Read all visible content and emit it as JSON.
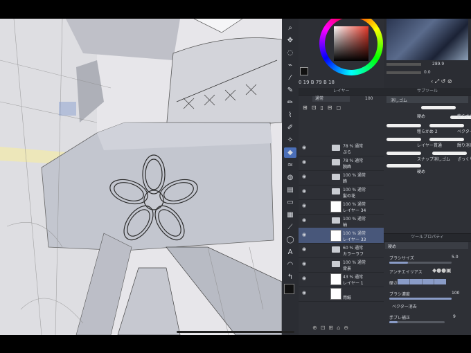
{
  "color": {
    "fg": "#111111",
    "bg": "#ffffff",
    "accent": "#4b6fb8",
    "readout": "0 19 B 79 B 18"
  },
  "navigator": {
    "zoom": "289.9",
    "angle": "0.0"
  },
  "layer_panel": {
    "title": "レイヤー",
    "blend_mode": "通常",
    "opacity": "100",
    "layers": [
      {
        "line1": "78 % 通常",
        "line2": "ぶら",
        "type": "folder",
        "selected": false
      },
      {
        "line1": "78 % 通常",
        "line2": "腕飾",
        "type": "folder",
        "selected": false
      },
      {
        "line1": "100 % 通常",
        "line2": "飾",
        "type": "folder",
        "selected": false
      },
      {
        "line1": "100 % 通常",
        "line2": "髪の花",
        "type": "folder",
        "selected": false
      },
      {
        "line1": "100 % 通常",
        "line2": "レイヤー 34",
        "type": "raster",
        "selected": false
      },
      {
        "line1": "100 % 通常",
        "line2": "袖",
        "type": "folder",
        "selected": false
      },
      {
        "line1": "100 % 通常",
        "line2": "レイヤー 33",
        "type": "raster",
        "selected": true
      },
      {
        "line1": "60 % 通常",
        "line2": "カラーラフ",
        "type": "folder",
        "selected": false
      },
      {
        "line1": "100 % 通常",
        "line2": "背景",
        "type": "folder",
        "selected": false
      },
      {
        "line1": "43 % 通常",
        "line2": "レイヤー 1",
        "type": "raster",
        "selected": false
      },
      {
        "line1": "",
        "line2": "用紙",
        "type": "paper",
        "selected": false
      }
    ]
  },
  "sub_tool": {
    "title": "サブツール",
    "group": "消しゴム",
    "brushes": [
      "硬め",
      "軟らかめ",
      "粗らかめ 2",
      "ベクター用",
      "レイヤー貫通",
      "輝り消しゴム",
      "スナップ消しゴム",
      "ざっくり",
      "硬め"
    ]
  },
  "tool_property": {
    "title": "ツールプロパティ",
    "tool": "硬め",
    "brush_size_label": "ブラシサイズ",
    "brush_size": "5.0",
    "antialias_label": "アンチエイリアス",
    "hardness_label": "硬さ",
    "density_label": "ブラシ濃度",
    "density": "100",
    "vector_label": "ベクター消去",
    "stabilization_label": "手ブレ補正",
    "stabilization": "9"
  }
}
